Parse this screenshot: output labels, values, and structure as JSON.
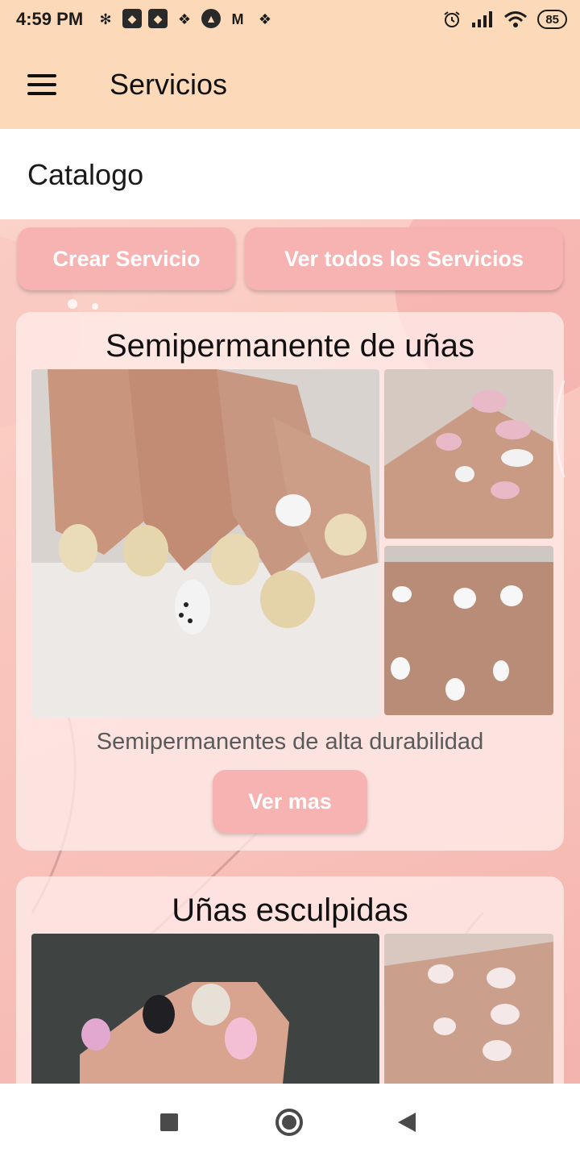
{
  "status_bar": {
    "time": "4:59 PM",
    "notification_icons": [
      "slack-icon",
      "app-icon",
      "app-icon",
      "dropbox-icon",
      "app-icon",
      "gmail-icon",
      "dropbox-icon"
    ],
    "battery": "85"
  },
  "app_bar": {
    "menu_icon": "hamburger-menu-icon",
    "title": "Servicios"
  },
  "page": {
    "section_title": "Catalogo"
  },
  "actions": {
    "create_label": "Crear Servicio",
    "view_all_label": "Ver todos los Servicios"
  },
  "services": [
    {
      "title": "Semipermanente de uñas",
      "description": "Semipermanentes de alta durabilidad",
      "button_label": "Ver mas"
    },
    {
      "title": "Uñas esculpidas"
    }
  ],
  "nav_bar": {
    "icons": [
      "recents-square-icon",
      "home-circle-icon",
      "back-triangle-icon"
    ]
  },
  "colors": {
    "app_bar": "#fcd9b8",
    "button": "#f7b3b1",
    "background_gradient_start": "#fbd3c8",
    "background_gradient_end": "#f4b3ad"
  }
}
